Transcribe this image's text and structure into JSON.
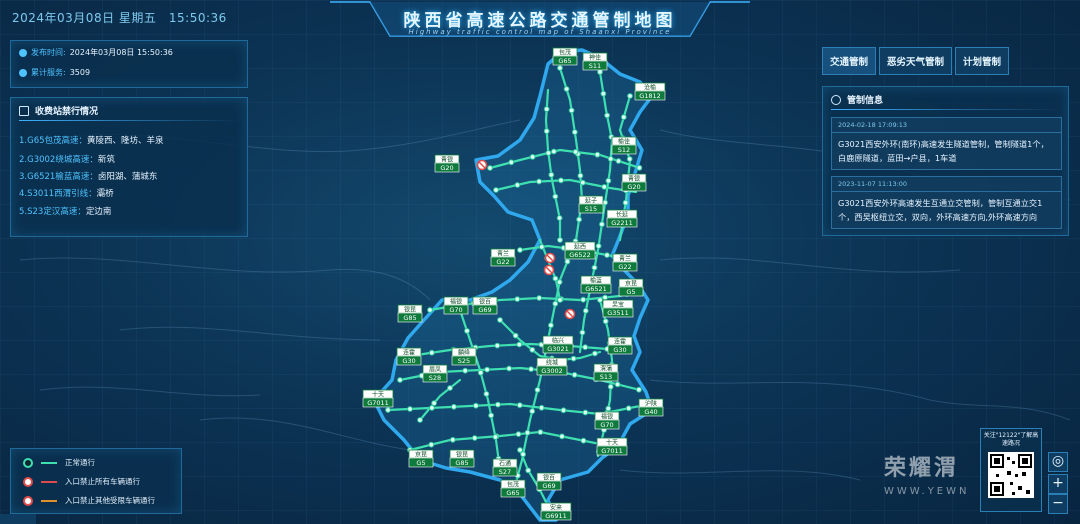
{
  "header": {
    "datetime": "2024年03月08日 星期五　15:50:36",
    "title": "陕西省高速公路交通管制地图",
    "subtitle": "Highway traffic control map of Shaanxi Province"
  },
  "info": {
    "publish_label": "发布时间:",
    "publish_value": "2024年03月08日 15:50:36",
    "service_label": "累计服务:",
    "service_value": "3509"
  },
  "stations": {
    "title": "收费站禁行情况",
    "items": [
      {
        "road": "1.G65包茂高速：",
        "places": "黄陵西、隆坊、羊泉"
      },
      {
        "road": "2.G3002绕城高速：",
        "places": "新筑"
      },
      {
        "road": "3.G6521榆蓝高速：",
        "places": "卤阳湖、蒲城东"
      },
      {
        "road": "4.S3011西渭引线：",
        "places": "灞桥"
      },
      {
        "road": "5.S23定汉高速：",
        "places": "定边南"
      }
    ]
  },
  "tabs": [
    "交通管制",
    "恶劣天气管制",
    "计划管制"
  ],
  "control": {
    "title": "管制信息",
    "cards": [
      {
        "time": "2024-02-18 17:09:13",
        "text": "G3021西安外环(南环)高速发生隧道管制，管制隧道1个，白鹿原隧道，蓝田→户县，1车道"
      },
      {
        "time": "2023-11-07 11:13:00",
        "text": "G3021西安外环高速发生互通立交管制，管制互通立交1个，西吴枢纽立交，双向，外环高速方向,外环高速方向"
      }
    ]
  },
  "legend": {
    "items": [
      {
        "label": "正常通行",
        "color": "#3ee0b0"
      },
      {
        "label": "入口禁止所有车辆通行",
        "color": "#e04a4a"
      },
      {
        "label": "入口禁止其他受限车辆通行",
        "color": "#e0902a"
      }
    ]
  },
  "qr": {
    "text": "关注\"12122\"了解高速路况"
  },
  "watermark": {
    "main": "荣耀渭",
    "sub": "WWW.YEWN"
  },
  "zoom": {
    "locate": "◎",
    "plus": "+",
    "minus": "−"
  },
  "signs": [
    {
      "name": "包茂",
      "code": "G65"
    },
    {
      "name": "神佳",
      "code": "S11"
    },
    {
      "name": "沧榆",
      "code": "G1812"
    },
    {
      "name": "榆佳",
      "code": "S12"
    },
    {
      "name": "青银",
      "code": "G20"
    },
    {
      "name": "青银",
      "code": "G20"
    },
    {
      "name": "延子",
      "code": "S15"
    },
    {
      "name": "长延",
      "code": "G2211"
    },
    {
      "name": "延西",
      "code": "G6522"
    },
    {
      "name": "青兰",
      "code": "G22"
    },
    {
      "name": "青兰",
      "code": "G22"
    },
    {
      "name": "榆蓝",
      "code": "G6521"
    },
    {
      "name": "京昆",
      "code": "G5"
    },
    {
      "name": "吴宝",
      "code": "G3511"
    },
    {
      "name": "银昆",
      "code": "G85"
    },
    {
      "name": "福银",
      "code": "G70"
    },
    {
      "name": "银百",
      "code": "G69"
    },
    {
      "name": "临兴",
      "code": "G3021"
    },
    {
      "name": "连霍",
      "code": "G30"
    },
    {
      "name": "连霍",
      "code": "G30"
    },
    {
      "name": "麟绛",
      "code": "S25"
    },
    {
      "name": "绕城",
      "code": "G3002"
    },
    {
      "name": "渭蒲",
      "code": "S13"
    },
    {
      "name": "眉凤",
      "code": "S28"
    },
    {
      "name": "十天",
      "code": "G7011"
    },
    {
      "name": "沪陕",
      "code": "G40"
    },
    {
      "name": "福银",
      "code": "G70"
    },
    {
      "name": "十天",
      "code": "G7011"
    },
    {
      "name": "京昆",
      "code": "G5"
    },
    {
      "name": "银昆",
      "code": "G85"
    },
    {
      "name": "石通",
      "code": "S27"
    },
    {
      "name": "包茂",
      "code": "G65"
    },
    {
      "name": "银百",
      "code": "G69"
    },
    {
      "name": "安来",
      "code": "G6911"
    }
  ]
}
